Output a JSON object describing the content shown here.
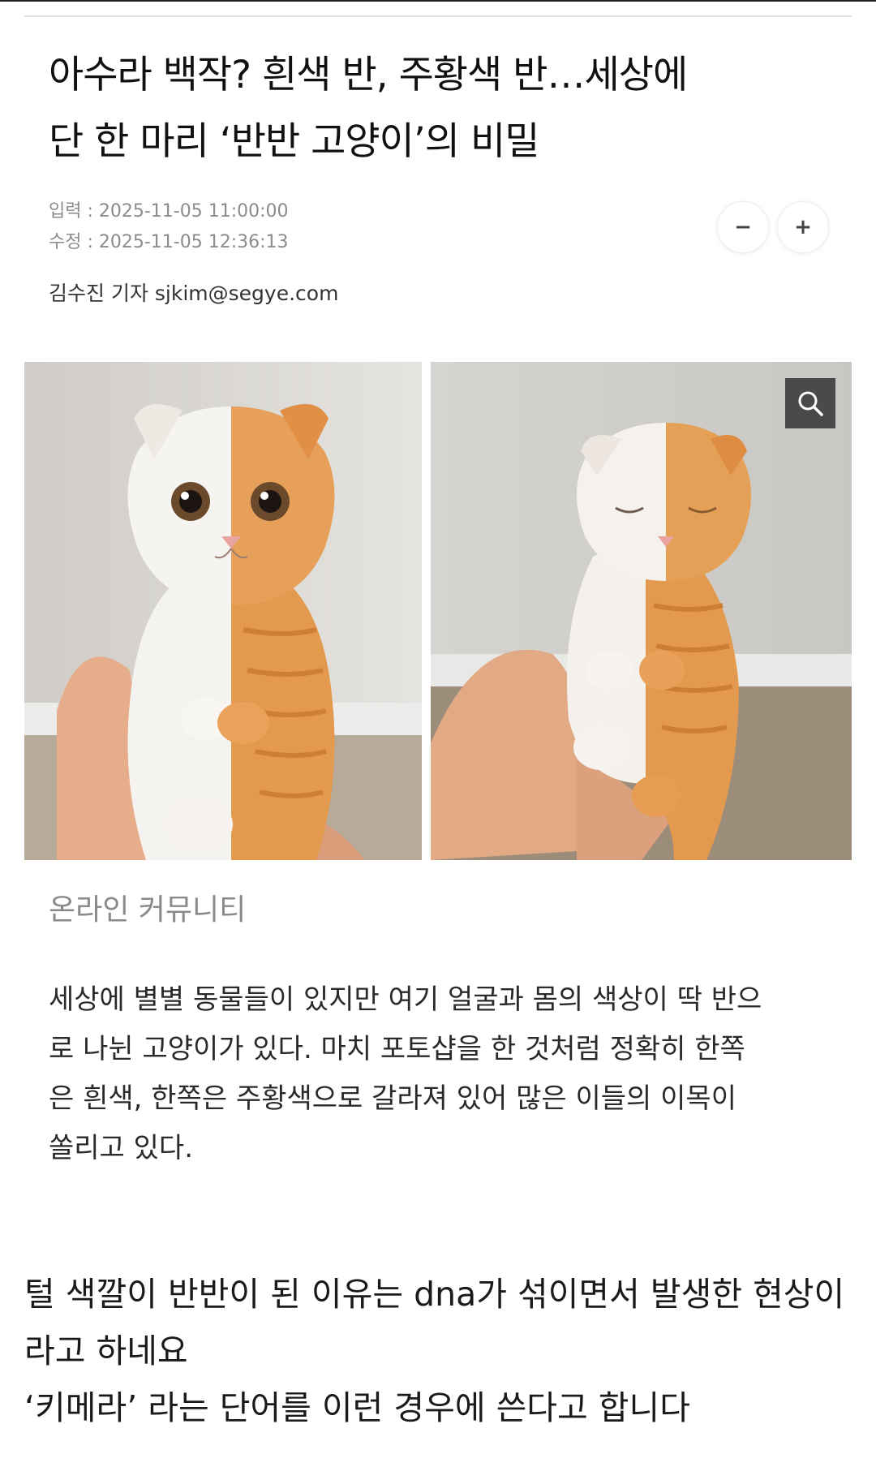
{
  "article": {
    "headline_line1": "아수라 백작? 흰색 반, 주황색 반…세상에",
    "headline_line2": "단 한 마리 ‘반반 고양이’의 비밀",
    "meta": {
      "input_label": "입력 : 2025-11-05 11:00:00",
      "modified_label": "수정 : 2025-11-05 12:36:13"
    },
    "font_controls": {
      "decrease": "−",
      "increase": "+"
    },
    "byline": "김수진 기자 sjkim@segye.com",
    "photo": {
      "caption": "온라인 커뮤니티",
      "zoom_icon": "search-icon"
    },
    "body_lines": [
      "세상에 별별 동물들이 있지만 여기 얼굴과 몸의 색상이 딱 반으",
      "로 나뉜 고양이가 있다. 마치 포토샵을 한 것처럼 정확히 한쪽",
      "은 흰색, 한쪽은 주황색으로 갈라져 있어 많은 이들의 이목이",
      "쏠리고 있다."
    ]
  },
  "post": {
    "lines": [
      "털 색깔이 반반이 된 이유는 dna가 섞이면서 발생한 현상이",
      "라고 하네요",
      "‘키메라’ 라는 단어를 이런 경우에 쓴다고 합니다"
    ]
  },
  "colors": {
    "wall": "#d9d7d3",
    "carpet": "#9a8c7c",
    "white_fur": "#f3f0ec",
    "orange_fur": "#e39a4e",
    "skin": "#e7b08e"
  }
}
